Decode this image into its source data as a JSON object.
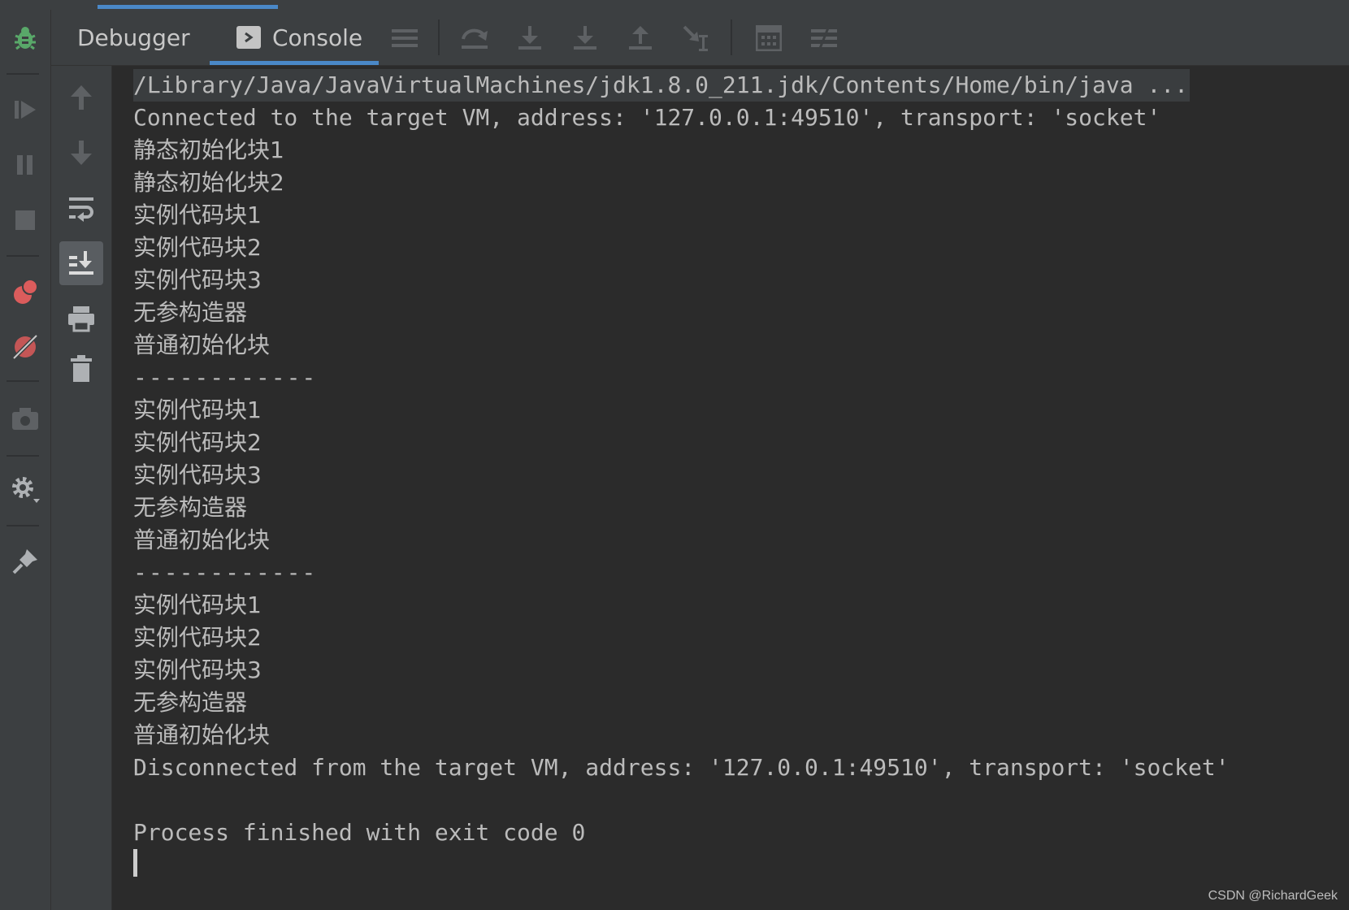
{
  "tabs": {
    "debugger_label": "Debugger",
    "console_label": "Console"
  },
  "icons": {
    "left": [
      "bug-icon",
      "resume-icon",
      "pause-icon",
      "stop-icon",
      "view-breakpoints-icon",
      "mute-breakpoints-icon",
      "camera-icon",
      "settings-icon",
      "pin-icon"
    ],
    "toolbar": [
      "list-icon",
      "step-over-icon",
      "step-into-icon",
      "force-step-into-icon",
      "step-out-icon",
      "run-to-cursor-icon",
      "evaluate-expression-icon",
      "trace-icon"
    ],
    "console_side": [
      "arrow-up-icon",
      "arrow-down-icon",
      "soft-wrap-icon",
      "scroll-to-end-icon",
      "print-icon",
      "trash-icon"
    ]
  },
  "colors": {
    "accent": "#4a88c7",
    "bug_green": "#59a869",
    "breakpoint_red": "#db5c5c"
  },
  "console": {
    "lines": [
      "/Library/Java/JavaVirtualMachines/jdk1.8.0_211.jdk/Contents/Home/bin/java ...",
      "Connected to the target VM, address: '127.0.0.1:49510', transport: 'socket'",
      "静态初始化块1",
      "静态初始化块2",
      "实例代码块1",
      "实例代码块2",
      "实例代码块3",
      "无参构造器",
      "普通初始化块",
      "------------",
      "实例代码块1",
      "实例代码块2",
      "实例代码块3",
      "无参构造器",
      "普通初始化块",
      "------------",
      "实例代码块1",
      "实例代码块2",
      "实例代码块3",
      "无参构造器",
      "普通初始化块",
      "Disconnected from the target VM, address: '127.0.0.1:49510', transport: 'socket'",
      "",
      "Process finished with exit code 0"
    ]
  },
  "watermark": "CSDN @RichardGeek"
}
